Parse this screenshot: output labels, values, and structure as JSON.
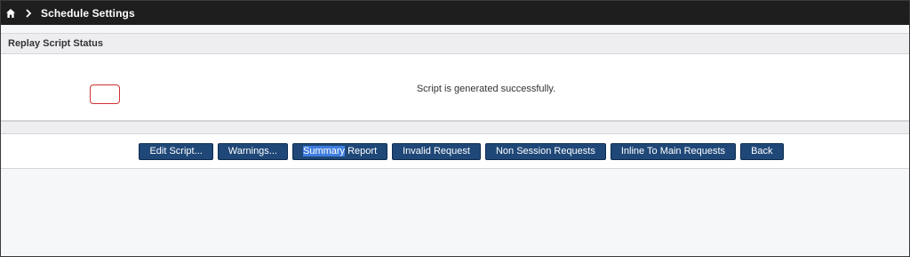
{
  "topbar": {
    "home_icon": "home-icon",
    "chevron_icon": "chevron-right-icon",
    "title": "Schedule Settings"
  },
  "section": {
    "title": "Replay Script Status"
  },
  "status": {
    "message": "Script is generated successfully."
  },
  "buttons": [
    {
      "label": "Edit Script..."
    },
    {
      "label": "Warnings..."
    },
    {
      "label_highlight": "Summary",
      "label_rest": " Report"
    },
    {
      "label": "Invalid Request"
    },
    {
      "label": "Non Session Requests"
    },
    {
      "label": "Inline To Main Requests"
    },
    {
      "label": "Back"
    }
  ],
  "colors": {
    "topbar_bg": "#1e1e1e",
    "button_bg": "#1f4878",
    "selection_highlight": "#3f7ee0",
    "annotation_border": "#d23232"
  }
}
